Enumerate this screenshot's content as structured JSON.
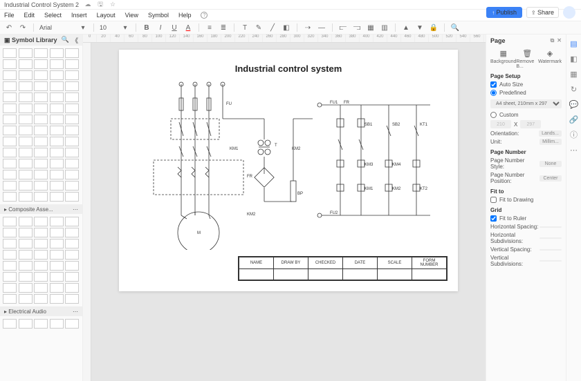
{
  "titlebar": {
    "doc_title": "Industrial Control System 2"
  },
  "menu": {
    "file": "File",
    "edit": "Edit",
    "select": "Select",
    "insert": "Insert",
    "layout": "Layout",
    "view": "View",
    "symbol": "Symbol",
    "help": "Help"
  },
  "actions": {
    "publish": "Publish",
    "share": "Share"
  },
  "toolbar": {
    "font": "Arial",
    "size": "10"
  },
  "left": {
    "library_title": "Symbol Library",
    "section_composite": "Composite Asse...",
    "section_audio": "Electrical Audio"
  },
  "canvas": {
    "page_title": "Industrial control system",
    "labels": {
      "FU": "FU",
      "KM1": "KM1",
      "KM2": "KM2",
      "FR": "FR",
      "BP": "BP",
      "M": "M",
      "T": "T",
      "FU1": "FU1",
      "FU2": "FU2",
      "SB1": "SB1",
      "SB2": "SB2",
      "KM3": "KM3",
      "KM4": "KM4",
      "KT1": "KT1",
      "KT2": "KT2"
    },
    "title_block": {
      "name": "NAME",
      "draw_by": "DRAW BY",
      "checked": "CHECKED",
      "date": "DATE",
      "scale": "SCALE",
      "form_number": "FORM NUMBER"
    }
  },
  "right": {
    "panel_title": "Page",
    "tab_bg": "Background",
    "tab_remove": "Remove B...",
    "tab_wm": "Watermark",
    "page_setup": "Page Setup",
    "auto_size": "Auto Size",
    "predefined": "Predefined",
    "paper": "A4 sheet, 210mm x 297 mm",
    "custom": "Custom",
    "w": "210",
    "x": "X",
    "h": "297",
    "orientation": "Orientation:",
    "orientation_val": "Lands...",
    "unit": "Unit:",
    "unit_val": "Millim...",
    "page_number": "Page Number",
    "pn_style": "Page Number Style:",
    "pn_style_val": "None",
    "pn_pos": "Page Number Position:",
    "pn_pos_val": "Center",
    "fit_to": "Fit to",
    "fit_drawing": "Fit to Drawing",
    "grid": "Grid",
    "fit_ruler": "Fit to Ruler",
    "h_spacing": "Horizontal Spacing:",
    "h_sub": "Horizontal Subdivisions:",
    "v_spacing": "Vertical Spacing:",
    "v_sub": "Vertical Subdivisions:"
  }
}
